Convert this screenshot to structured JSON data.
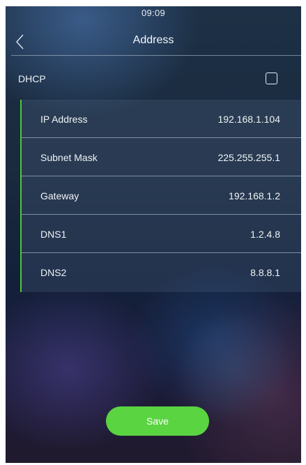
{
  "status_bar": {
    "time": "09:09"
  },
  "header": {
    "title": "Address",
    "back_icon": "chevron-left-icon"
  },
  "dhcp": {
    "label": "DHCP",
    "checked": false
  },
  "fields": [
    {
      "label": "IP Address",
      "value": "192.168.1.104"
    },
    {
      "label": "Subnet Mask",
      "value": "225.255.255.1"
    },
    {
      "label": "Gateway",
      "value": "192.168.1.2"
    },
    {
      "label": "DNS1",
      "value": "1.2.4.8"
    },
    {
      "label": "DNS2",
      "value": "8.8.8.1"
    }
  ],
  "save_button": {
    "label": "Save"
  },
  "colors": {
    "accent": "#5ad441",
    "panel_border": "#4cc641",
    "text": "#ffffff"
  }
}
